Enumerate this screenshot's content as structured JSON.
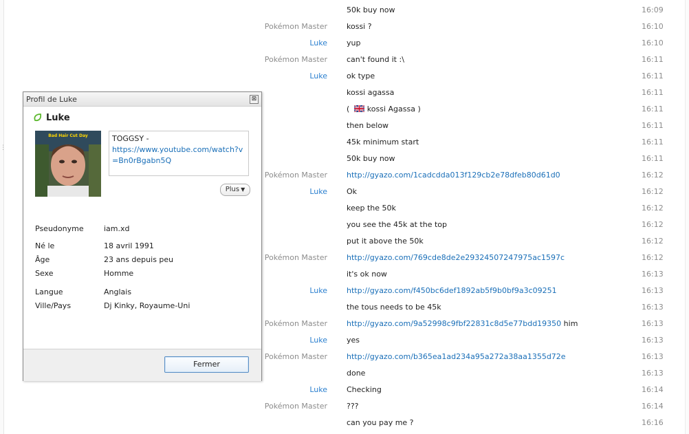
{
  "chat": {
    "rows": [
      {
        "sender": "",
        "text": "50k buy now",
        "link": "",
        "time": "16:09"
      },
      {
        "sender": "Pokémon Master",
        "text": "kossi ?",
        "link": "",
        "time": "16:10"
      },
      {
        "sender": "Luke",
        "text": "yup",
        "link": "",
        "time": "16:10"
      },
      {
        "sender": "Pokémon Master",
        "text": "can't found it :\\",
        "link": "",
        "time": "16:11"
      },
      {
        "sender": "Luke",
        "text": "ok type",
        "link": "",
        "time": "16:11"
      },
      {
        "sender": "",
        "text": "kossi agassa",
        "link": "",
        "time": "16:11"
      },
      {
        "sender": "",
        "text": "",
        "link": "",
        "time": "16:11"
      },
      {
        "sender": "",
        "text": "then below",
        "link": "",
        "time": "16:11"
      },
      {
        "sender": "",
        "text": "45k minimum start",
        "link": "",
        "time": "16:11"
      },
      {
        "sender": "",
        "text": "50k buy now",
        "link": "",
        "time": "16:11"
      },
      {
        "sender": "Pokémon Master",
        "text": "",
        "link": "http://gyazo.com/1cadcdda013f129cb2e78dfeb80d61d0",
        "time": "16:12"
      },
      {
        "sender": "Luke",
        "text": "Ok",
        "link": "",
        "time": "16:12"
      },
      {
        "sender": "",
        "text": "keep the 50k",
        "link": "",
        "time": "16:12"
      },
      {
        "sender": "",
        "text": "you see the 45k at the top",
        "link": "",
        "time": "16:12"
      },
      {
        "sender": "",
        "text": "put it above the 50k",
        "link": "",
        "time": "16:12"
      },
      {
        "sender": "Pokémon Master",
        "text": "",
        "link": "http://gyazo.com/769cde8de2e29324507247975ac1597c",
        "time": "16:12"
      },
      {
        "sender": "",
        "text": "it's ok now",
        "link": "",
        "time": "16:13"
      },
      {
        "sender": "Luke",
        "text": "",
        "link": "http://gyazo.com/f450bc6def1892ab5f9b0bf9a3c09251",
        "time": "16:13"
      },
      {
        "sender": "",
        "text": "the tous needs to be 45k",
        "link": "",
        "time": "16:13"
      },
      {
        "sender": "Pokémon Master",
        "text": " him",
        "link": "http://gyazo.com/9a52998c9fbf22831c8d5e77bdd19350",
        "time": "16:13"
      },
      {
        "sender": "Luke",
        "text": "yes",
        "link": "",
        "time": "16:13"
      },
      {
        "sender": "Pokémon Master",
        "text": "",
        "link": "http://gyazo.com/b365ea1ad234a95a272a38aa1355d72e",
        "time": "16:13"
      },
      {
        "sender": "",
        "text": "done",
        "link": "",
        "time": "16:13"
      },
      {
        "sender": "Luke",
        "text": "Checking",
        "link": "",
        "time": "16:14"
      },
      {
        "sender": "Pokémon Master",
        "text": "???",
        "link": "",
        "time": "16:14"
      },
      {
        "sender": "",
        "text": "can you pay me ?",
        "link": "",
        "time": "16:16"
      }
    ],
    "flag_row": {
      "open": "( ",
      "text": "kossi Agassa",
      "close": " )"
    }
  },
  "profile": {
    "window_title": "Profil de Luke",
    "close_glyph": "⊠",
    "name": "Luke",
    "mood_text": "TOGGSY -",
    "mood_link": "https://www.youtube.com/watch?v=Bn0rBgabn5Q",
    "plus_label": "Plus",
    "avatar_caption": "Bad Hair Cut Day",
    "fields": [
      {
        "label": "Pseudonyme",
        "value": "iam.xd"
      },
      {
        "label": "Né le",
        "value": "18 avril 1991"
      },
      {
        "label": "Âge",
        "value": "23 ans depuis peu"
      },
      {
        "label": "Sexe",
        "value": "Homme"
      },
      {
        "label": "Langue",
        "value": "Anglais"
      },
      {
        "label": "Ville/Pays",
        "value": "Dj Kinky, Royaume-Uni"
      }
    ],
    "close_button_label": "Fermer"
  },
  "colors": {
    "link": "#1a6fb8",
    "luke": "#2a7fcf",
    "muted": "#8c8c8c",
    "accent_border": "#5b8fc4"
  }
}
